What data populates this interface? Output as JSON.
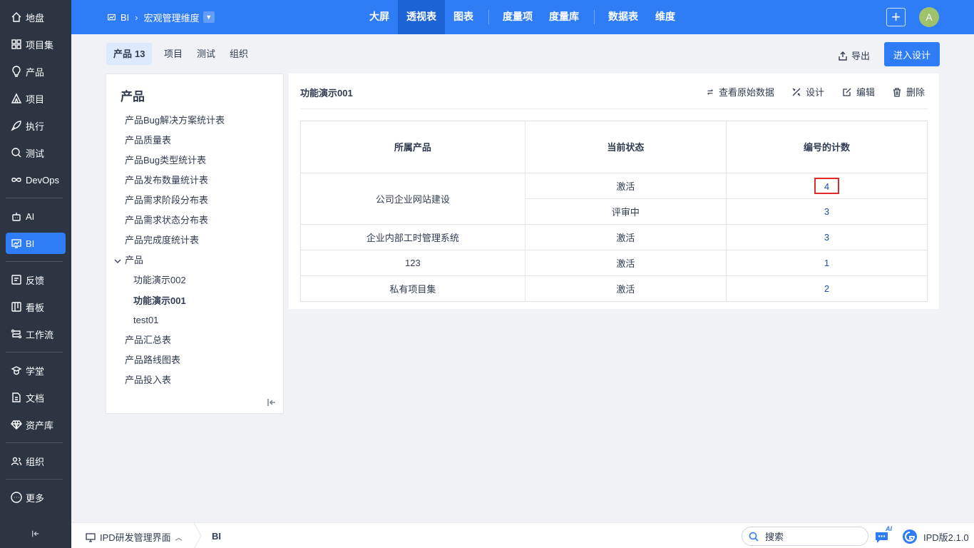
{
  "sidebar": {
    "items": [
      {
        "label": "地盘",
        "icon": "home-icon"
      },
      {
        "label": "项目集",
        "icon": "grid-icon"
      },
      {
        "label": "产品",
        "icon": "bulb-icon"
      },
      {
        "label": "项目",
        "icon": "tent-icon"
      },
      {
        "label": "执行",
        "icon": "rocket-icon"
      },
      {
        "label": "测试",
        "icon": "search-icon"
      },
      {
        "label": "DevOps",
        "icon": "infinity-icon"
      },
      {
        "label": "AI",
        "icon": "robot-icon"
      },
      {
        "label": "BI",
        "icon": "chart-icon"
      },
      {
        "label": "反馈",
        "icon": "feedback-icon"
      },
      {
        "label": "看板",
        "icon": "kanban-icon"
      },
      {
        "label": "工作流",
        "icon": "workflow-icon"
      },
      {
        "label": "学堂",
        "icon": "school-icon"
      },
      {
        "label": "文档",
        "icon": "doc-icon"
      },
      {
        "label": "资产库",
        "icon": "diamond-icon"
      },
      {
        "label": "组织",
        "icon": "users-icon"
      },
      {
        "label": "更多",
        "icon": "more-icon"
      }
    ],
    "active": "BI"
  },
  "header": {
    "breadcrumb": {
      "module": "BI",
      "dimension": "宏观管理维度"
    },
    "nav": [
      "大屏",
      "透视表",
      "图表",
      "度量项",
      "度量库",
      "数据表",
      "维度"
    ],
    "active_nav": "透视表",
    "avatar_letter": "A"
  },
  "tabs": {
    "items": [
      {
        "label": "产品",
        "count": "13"
      },
      {
        "label": "项目"
      },
      {
        "label": "测试"
      },
      {
        "label": "组织"
      }
    ],
    "export_label": "导出",
    "design_label": "进入设计"
  },
  "tree": {
    "title": "产品",
    "items": [
      "产品Bug解决方案统计表",
      "产品质量表",
      "产品Bug类型统计表",
      "产品发布数量统计表",
      "产品需求阶段分布表",
      "产品需求状态分布表",
      "产品完成度统计表"
    ],
    "group": {
      "label": "产品",
      "children": [
        "功能演示002",
        "功能演示001",
        "test01"
      ]
    },
    "after": [
      "产品汇总表",
      "产品路线图表",
      "产品投入表"
    ]
  },
  "pivot": {
    "title": "功能演示001",
    "actions": {
      "view_raw": "查看原始数据",
      "design": "设计",
      "edit": "编辑",
      "delete": "删除"
    },
    "columns": [
      "所属产品",
      "当前状态",
      "编号的计数"
    ],
    "rows": [
      {
        "product": "公司企业网站建设",
        "status": "激活",
        "count": "4"
      },
      {
        "product": "",
        "status": "评审中",
        "count": "3"
      },
      {
        "product": "企业内部工时管理系统",
        "status": "激活",
        "count": "3"
      },
      {
        "product": "123",
        "status": "激活",
        "count": "1"
      },
      {
        "product": "私有项目集",
        "status": "激活",
        "count": "2"
      }
    ]
  },
  "bottom": {
    "workspace": "IPD研发管理界面",
    "current": "BI",
    "search_placeholder": "搜索",
    "ai_badge": "AI",
    "version": "IPD版2.1.0"
  },
  "colors": {
    "primary": "#2e7cf6",
    "sidebar": "#2d3442",
    "highlight": "#e02b2b"
  }
}
